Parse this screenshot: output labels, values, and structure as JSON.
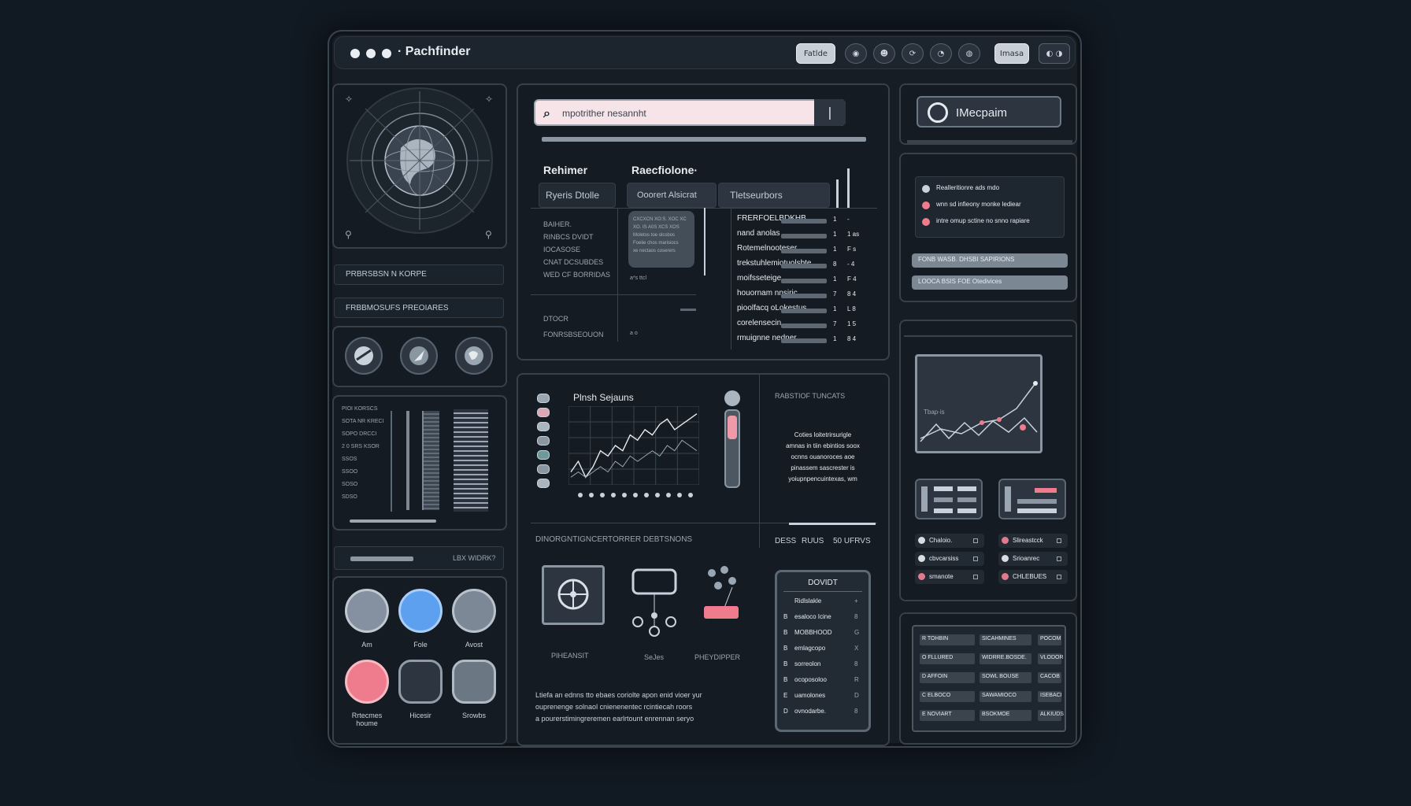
{
  "app": {
    "title": "· Pachfinder"
  },
  "toolbar": {
    "btn1": "Fatlde",
    "btn2": "Imasa"
  },
  "left": {
    "row1": "PRBRSBSN N KORPE",
    "row2": "FRBBMOSUFS PREOIARES",
    "chart_labels": [
      "PIOI KORSCS",
      "SOTA NR KRECI",
      "SOPO DRCCI",
      "2 0 SRS KSOR",
      "SSOS",
      "SSOO",
      "SOSO",
      "SDSO"
    ],
    "footer_right": "LBX WIDRK?",
    "apps": [
      {
        "label": "Am"
      },
      {
        "label": "Fole"
      },
      {
        "label": "Avost"
      },
      {
        "label": "Rrtecmes\nhoume"
      },
      {
        "label": "Hicesir"
      },
      {
        "label": "Srowbs"
      }
    ]
  },
  "search": {
    "placeholder": "mpotrither nesannht"
  },
  "table": {
    "header_left": "Rehimer",
    "header_right": "Raecfiolone·",
    "tab1": "Ryeris Dtolle",
    "tab2": "Ooorert Alsicrat",
    "tab3": "Tletseurbors",
    "side_items": [
      "BAIHER.",
      "RINBCS DVIDT",
      "IOCASOSE",
      "CNAT DCSUBDES",
      "WED CF BORRIDAS"
    ],
    "side_bottom1": "DTOCR",
    "side_bottom2": "FONRSBSEOUON",
    "mid_text": "CXCXCN XO:S. XOC XC\nXO. IS A0S XCS XOS\nMoletos toe olcsbos\nFoelie chos marisiocs\nxe nectaos coserers",
    "mid_foot": "a*s  ttcl",
    "mid_foot2": "a  o",
    "rows": [
      {
        "name": "FRERFOELBDKHB.",
        "v1": "1",
        "v2": "-"
      },
      {
        "name": "nand anolas",
        "v1": "1",
        "v2": "1 as"
      },
      {
        "name": "Rotemelnooteser",
        "v1": "1",
        "v2": "F s"
      },
      {
        "name": "trekstuhlemiotuolsbte",
        "v1": "8",
        "v2": "- 4"
      },
      {
        "name": "moifsseteige",
        "v1": "1",
        "v2": "F 4"
      },
      {
        "name": "houornam nnsiric",
        "v1": "7",
        "v2": "8 4"
      },
      {
        "name": "pioolfacq oLokestus",
        "v1": "1",
        "v2": "L 8"
      },
      {
        "name": "corelensecin",
        "v1": "7",
        "v2": "1 5"
      },
      {
        "name": "rmuignne nedner",
        "v1": "1",
        "v2": "8 4"
      }
    ]
  },
  "plot": {
    "title": "Plnsh Sejauns",
    "right_title": "RABSTIOF TUNCATS",
    "right_text": [
      "Coties loitetrirsurigle",
      "amnas in tiin ebintios soox",
      "ocnns ouanoroces aoe",
      "pinassem sascrester is",
      "yoiupnpencuintexas, wm"
    ],
    "bottom_heading": "DINORGNTIGNCERTORRER DEBTSNONS",
    "bottom_tabs": [
      "DESS",
      "RUUS",
      "50 UFRVS"
    ],
    "tools": [
      "PIHEANSIT",
      "SeJes",
      "PHEYDIPPER"
    ],
    "footer_text": [
      "Ltiefa an ednns tto ebaes coriolte apon enid vioer yur",
      "ouprenenge solnaol cnienenentec rcintiecah roors",
      "a pourerstimingreremen earlrtount enrennan seryo"
    ]
  },
  "chart_data": {
    "type": "line",
    "x": [
      1,
      2,
      3,
      4,
      5,
      6,
      7,
      8,
      9,
      10,
      11,
      12,
      13,
      14,
      15,
      16,
      17,
      18
    ],
    "series": [
      {
        "values": [
          2,
          4,
          1,
          3,
          6,
          5,
          7,
          6,
          9,
          8,
          10,
          9,
          11,
          12,
          10,
          11,
          12,
          13
        ]
      },
      {
        "values": [
          1,
          2,
          1,
          2,
          3,
          2,
          4,
          3,
          5,
          4,
          5,
          6,
          5,
          7,
          6,
          8,
          7,
          6
        ]
      }
    ],
    "title": "Plnsh Sejauns",
    "grid": true
  },
  "dropdown": {
    "title": "DOVIDT",
    "items": [
      {
        "letter": "",
        "label": "Ridlslakle",
        "mark": "+"
      },
      {
        "letter": "B",
        "label": "esaloco Icine",
        "mark": "8"
      },
      {
        "letter": "B",
        "label": "MOBBHOOD",
        "mark": "G"
      },
      {
        "letter": "B",
        "label": "emlagcopo",
        "mark": "X"
      },
      {
        "letter": "B",
        "label": "sorreolon",
        "mark": "8"
      },
      {
        "letter": "B",
        "label": "ocoposoloo",
        "mark": "R"
      },
      {
        "letter": "E",
        "label": "uamolones",
        "mark": "D"
      },
      {
        "letter": "D",
        "label": "ovnodarbe.",
        "mark": "8"
      }
    ]
  },
  "right": {
    "logo_label": "IMecpaim",
    "list": [
      "Realleritionre ads mdo",
      "wnn sd infieony monke lediear",
      "intre omup sctine no snno rapiare"
    ],
    "btn1": "FONB WASB. DHSBI SAPIRIONS",
    "btn2": "LOOCA BSIS FOE Otedivices",
    "graph_label": "Tbap·is",
    "chips": [
      {
        "label": "Chaloio.",
        "color": "#d8dde3"
      },
      {
        "label": "Slireastcck",
        "color": "#e07b8c"
      },
      {
        "label": "cbvcarsiss",
        "color": "#d8dde3"
      },
      {
        "label": "Srioanrec",
        "color": "#d8dde3"
      },
      {
        "label": "smanote",
        "color": "#e07b8c"
      },
      {
        "label": "CHLEBUES",
        "color": "#e07b8c"
      }
    ],
    "grid_rows": [
      [
        "R TOHBIN",
        "SICAHMINES",
        "POCOM"
      ],
      [
        "O FLLURED",
        "WIDRRE.BOSDE.",
        "VLODOR"
      ],
      [
        "D AFFOIN",
        "SOWL BOUSE",
        "CACOB"
      ],
      [
        "C ELBOCO",
        "SAWAMIOCO",
        "ISEBACI"
      ],
      [
        "E NOVIART",
        "BSOKMOE",
        "ALKIUDS"
      ]
    ]
  }
}
